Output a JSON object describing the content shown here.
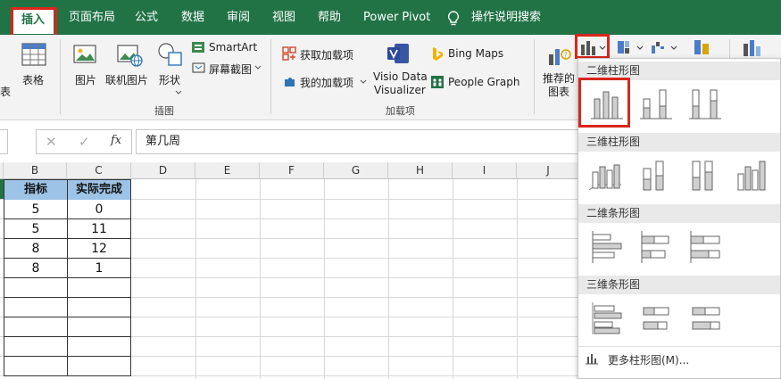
{
  "ribbon_tabs": {
    "insert": "插入",
    "page_layout": "页面布局",
    "formulas": "公式",
    "data": "数据",
    "review": "审阅",
    "view": "视图",
    "help": "帮助",
    "power_pivot": "Power Pivot",
    "tell_me": "操作说明搜索"
  },
  "ribbon": {
    "chart_partial": "表",
    "table": "表格",
    "pictures": "图片",
    "online_pictures": "联机图片",
    "shapes": "形状",
    "smartart": "SmartArt",
    "screenshot": "屏幕截图",
    "illustrations_group": "插图",
    "get_addins": "获取加载项",
    "my_addins": "我的加载项",
    "visio": "Visio Data Visualizer",
    "visio_line1": "Visio Data",
    "visio_line2": "Visualizer",
    "bing_maps": "Bing Maps",
    "people_graph": "People Graph",
    "addins_group": "加载项",
    "recommended_line1": "推荐的",
    "recommended_line2": "图表"
  },
  "formula_bar": {
    "cancel": "✕",
    "enter": "✓",
    "fx": "fx",
    "value": "第几周"
  },
  "columns": [
    "B",
    "C",
    "D",
    "E",
    "F",
    "G",
    "H",
    "I",
    "J"
  ],
  "table": {
    "headers": [
      "指标",
      "实际完成"
    ],
    "rows": [
      [
        "5",
        "0"
      ],
      [
        "5",
        "11"
      ],
      [
        "8",
        "12"
      ],
      [
        "8",
        "1"
      ]
    ]
  },
  "dropdown": {
    "sections": [
      {
        "title": "二维柱形图"
      },
      {
        "title": "三维柱形图"
      },
      {
        "title": "二维条形图"
      },
      {
        "title": "三维条形图"
      }
    ],
    "more": "更多柱形图(M)...",
    "more_underline": "M"
  },
  "colors": {
    "excel_green": "#217346",
    "highlight_red": "#d9261c",
    "table_header_fill": "#9dc3e6"
  }
}
